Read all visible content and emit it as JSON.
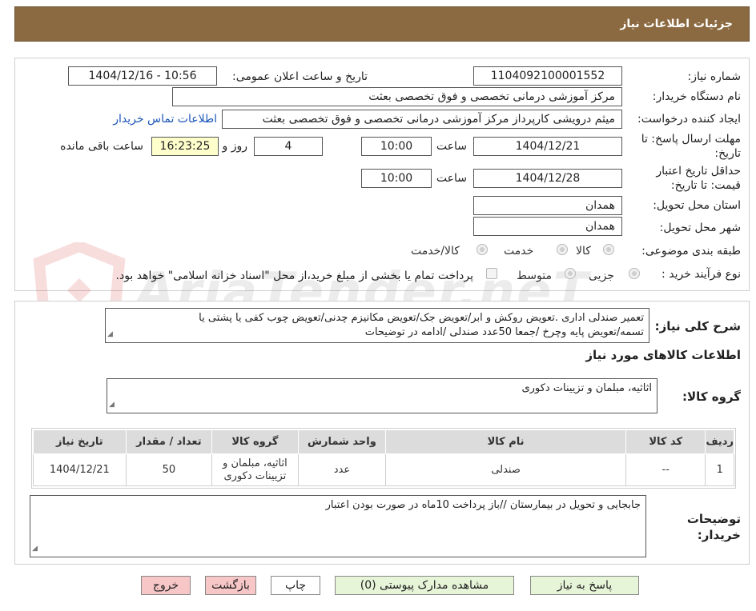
{
  "header": {
    "title": "جزئیات اطلاعات نیاز"
  },
  "fields": {
    "need_number_label": "شماره نیاز:",
    "need_number": "1104092100001552",
    "announce_label": "تاریخ و ساعت اعلان عمومی:",
    "announce_value": "1404/12/16 - 10:56",
    "buyer_org_label": "نام دستگاه خریدار:",
    "buyer_org": "مرکز آموزشی درمانی تخصصی و فوق تخصصی بعثت",
    "requester_label": "ایجاد کننده درخواست:",
    "requester": "میثم درویشی کارپرداز مرکز آموزشی درمانی تخصصی و فوق تخصصی بعثت",
    "contact_link": "اطلاعات تماس خریدار",
    "deadline_label": "مهلت ارسال پاسخ: تا تاریخ:",
    "deadline_date": "1404/12/21",
    "time_label": "ساعت",
    "deadline_time": "10:00",
    "days_value": "4",
    "days_label": "روز و",
    "remaining_time": "16:23:25",
    "remaining_label": "ساعت باقی مانده",
    "validity_label": "حداقل تاریخ اعتبار قیمت: تا تاریخ:",
    "validity_date": "1404/12/28",
    "validity_time": "10:00",
    "province_label": "استان محل تحویل:",
    "province": "همدان",
    "city_label": "شهر محل تحویل:",
    "city": "همدان",
    "category_label": "طبقه بندی موضوعی:",
    "category_options": [
      "کالا",
      "خدمت",
      "کالا/خدمت"
    ],
    "process_label": "نوع فرآیند خرید :",
    "process_options": [
      "جزیی",
      "متوسط"
    ],
    "payment_note": "پرداخت تمام یا بخشی از مبلغ خرید،از محل \"اسناد خزانه اسلامی\" خواهد بود."
  },
  "details": {
    "summary_label": "شرح کلی نیاز:",
    "summary_line1": "تعمیر صندلی اداری .تعویض روکش و ابر/تعویض جک/تعویض مکانیزم چدنی/تعویض چوب کفی یا پشتی یا",
    "summary_line2": "تسمه/تعویض پایه وچرخ /جمعا 50عدد صندلی /ادامه در توضیحات",
    "goods_info_title": "اطلاعات کالاهای مورد نیاز",
    "goods_group_label": "گروه کالا:",
    "goods_group": "اثاثیه، مبلمان و تزیینات دکوری",
    "buyer_notes_label": "توضیحات خریدار:",
    "buyer_notes": "جابجایی و تحویل در بیمارستان //باز پرداخت 10ماه در صورت بودن اعتبار"
  },
  "table": {
    "headers": {
      "row": "ردیف",
      "code": "کد کالا",
      "name": "نام کالا",
      "unit": "واحد شمارش",
      "group": "گروه کالا",
      "qty": "تعداد / مقدار",
      "date": "تاریخ نیاز"
    },
    "rows": [
      {
        "row": "1",
        "code": "--",
        "name": "صندلی",
        "unit": "عدد",
        "group": "اثاثیه، مبلمان و تزیینات دکوری",
        "qty": "50",
        "date": "1404/12/21"
      }
    ]
  },
  "buttons": {
    "reply": "پاسخ به نیاز",
    "attachments": "مشاهده مدارک پیوستی (0)",
    "print": "چاپ",
    "back": "بازگشت",
    "exit": "خروج"
  },
  "watermark": {
    "text": "AriaTender.neT"
  },
  "colors": {
    "header_bg": "#8b6a42",
    "remaining_bg": "#ffffcc",
    "link": "#1a55b8",
    "btn_green": "#e6f5d8",
    "btn_pink": "#f7c6c6"
  }
}
